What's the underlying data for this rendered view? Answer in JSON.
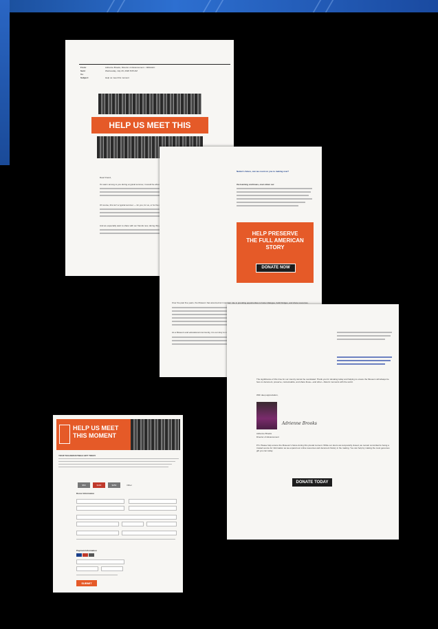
{
  "colors": {
    "accent": "#e55a28",
    "background": "#000000",
    "paper": "#f7f6f3"
  },
  "email": {
    "header_labels": [
      "From:",
      "Sent:",
      "To:",
      "Subject:"
    ],
    "header_values": [
      "Adrienne Brooks, Director of Advancement - NMAAHC",
      "Wednesday, July 29, 2020 8:05 AM",
      "",
      "Help us meet this moment"
    ],
    "banner": "HELP US MEET THIS MOMENT",
    "greeting": "Dear Friend,",
    "para1": "It's warm among to you during a typical summer, it would be when the students,",
    "para2": "Of course, this isn't a typical summer — for you, for us, or for the nation.",
    "para3": "And we especially want to share with our friends now, during this pivotal time in"
  },
  "appeal": {
    "question": "Nation's future, can we count on you to making now?",
    "bold_intro": "the learning continues, even when our",
    "box_title": "HELP PRESERVE THE FULL AMERICAN STORY",
    "donate_button": "DONATE NOW",
    "para_bottom": "Over the past five years, the Museum has assumed an important role in providing opportunities to foster dialogue, build bridges, and share resources.",
    "para_bottom2": "As a Museum and educational community, it is our duty to meet this moment and lead the way by doing more."
  },
  "letter": {
    "para": "The significance of this time for our country cannot be overstated. Thank you for donating today and helping to ensure the Museum will always be here to document, preserve, contextualize, and share these—and other—historic moments with the world.",
    "closing": "With deep appreciation,",
    "signature": "Adrienne Brooks",
    "name": "Adrienne Brooks",
    "title": "Director of Advancement",
    "ps": "P.S. Please help ensure the Museum's future during this pivotal moment. While our doors are temporarily closed, we remain committed to being a trusted source for information as we expand our online resources and document history in the making. You can help by making the most generous gift you can today.",
    "donate_button": "DONATE TODAY"
  },
  "form": {
    "banner": "HELP US MEET THIS MOMENT",
    "heading": "YOUR TAX-DEDUCTIBLE GIFT TODAY",
    "amount_options": [
      "$50",
      "$100",
      "$250",
      "Other"
    ],
    "sections": [
      "Donor Information",
      "Payment Information"
    ],
    "submit": "SUBMIT"
  }
}
